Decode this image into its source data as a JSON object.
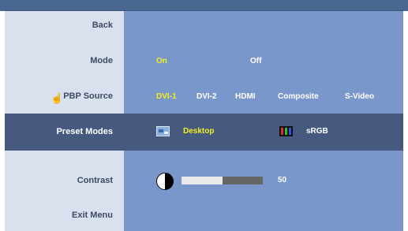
{
  "menu": {
    "back": "Back",
    "mode": "Mode",
    "pbp_source": "PBP Source",
    "preset_modes": "Preset Modes",
    "contrast": "Contrast",
    "exit_menu": "Exit Menu"
  },
  "mode_options": {
    "on": "On",
    "off": "Off",
    "selected": "On"
  },
  "pbp_sources": [
    "DVI-1",
    "DVI-2",
    "HDMI",
    "Composite",
    "S-Video"
  ],
  "pbp_selected": "DVI-1",
  "preset_options": {
    "desktop": "Desktop",
    "srgb": "sRGB",
    "selected": "Desktop"
  },
  "contrast": {
    "value": "50",
    "level": 0.5
  },
  "colors": {
    "header": "#4a6791",
    "left_panel": "#d9e0ee",
    "right_panel": "#7a97cc",
    "selected_row": "#465a80",
    "active_option": "#f2f020"
  },
  "icons": {
    "desktop": "desktop-preset-icon",
    "srgb": "srgb-preset-icon",
    "contrast": "contrast-half-circle-icon",
    "cursor": "hand-pointer-cursor-icon"
  }
}
